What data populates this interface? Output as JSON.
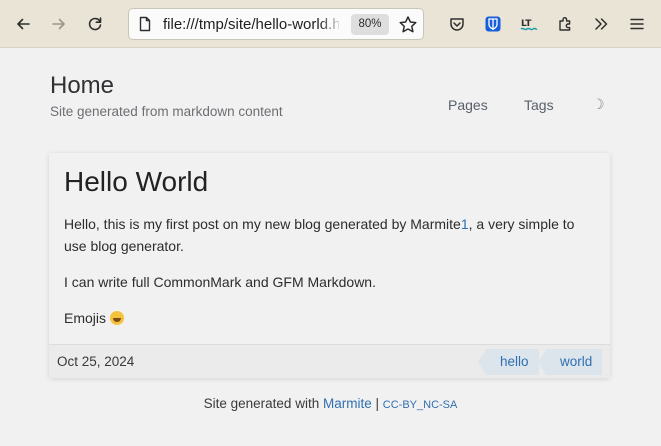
{
  "browser": {
    "url": "file:///tmp/site/hello-world.html",
    "zoom": "80%"
  },
  "site": {
    "title": "Home",
    "subtitle": "Site generated from markdown content",
    "nav": [
      "Pages",
      "Tags"
    ],
    "theme_toggle": "☽"
  },
  "post": {
    "title": "Hello World",
    "intro_before_link": "Hello, this is my first post on my new blog generated by Marmite",
    "footnote_ref": "1",
    "intro_after_link": ", a very simple to use blog generator.",
    "line2": "I can write full CommonMark and GFM Markdown.",
    "line3": "Emojis",
    "date": "Oct 25, 2024",
    "tags": [
      "hello",
      "world"
    ]
  },
  "footer": {
    "prefix": "Site generated with",
    "link": "Marmite",
    "separator": "|",
    "license": "CC-BY_NC-SA"
  },
  "colors": {
    "toolbar_bg": "#e9e4d6",
    "page_bg": "#f2f1f1",
    "link": "#2f6fb0",
    "tag_bg": "#dde5ec"
  }
}
